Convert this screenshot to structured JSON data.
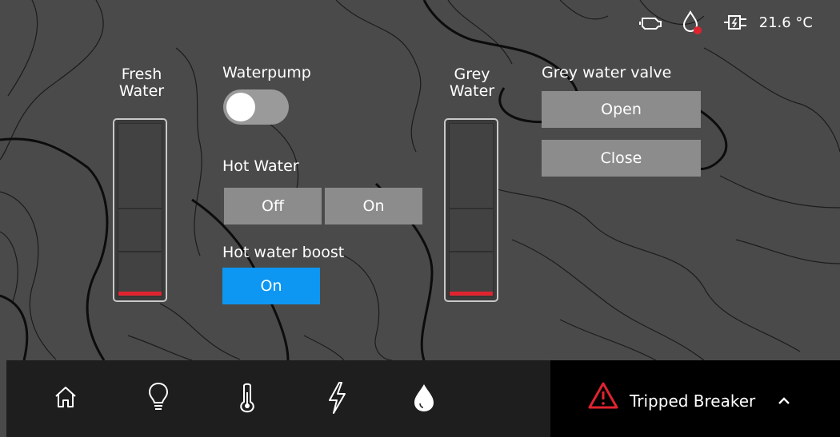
{
  "status": {
    "temperature": "21.6 °C",
    "icons": [
      "engine-icon",
      "water-drop-alert-icon",
      "shore-power-icon"
    ]
  },
  "fresh_water": {
    "label_line1": "Fresh",
    "label_line2": "Water",
    "level_percent": 3
  },
  "grey_water": {
    "label_line1": "Grey",
    "label_line2": "Water",
    "level_percent": 3
  },
  "waterpump": {
    "label": "Waterpump",
    "state": "off"
  },
  "hot_water": {
    "label": "Hot Water",
    "off_label": "Off",
    "on_label": "On"
  },
  "hot_water_boost": {
    "label": "Hot water boost",
    "on_label": "On"
  },
  "grey_water_valve": {
    "label": "Grey water valve",
    "open_label": "Open",
    "close_label": "Close"
  },
  "nav": {
    "items": [
      "home-icon",
      "lightbulb-icon",
      "thermometer-icon",
      "lightning-icon",
      "water-drop-icon"
    ],
    "active": "water-drop-icon"
  },
  "alert": {
    "label": "Tripped Breaker",
    "color": "#e0242f"
  },
  "colors": {
    "background": "#4a4a4a",
    "button": "#8c8c8c",
    "active_button": "#0d96f2",
    "level_indicator": "#e0242f"
  }
}
